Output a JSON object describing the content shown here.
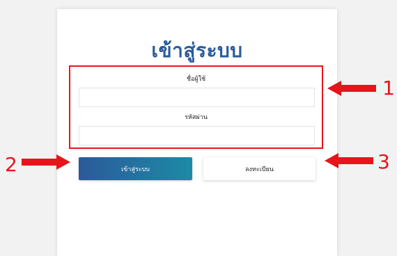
{
  "title": "เข้าสู่ระบบ",
  "form": {
    "username_label": "ชื่อผู้ใช้",
    "username_value": "",
    "password_label": "รหัสผ่าน",
    "password_value": ""
  },
  "buttons": {
    "login_label": "เข้าสู่ระบบ",
    "register_label": "ลงทะเบียน"
  },
  "annotations": {
    "n1": "1",
    "n2": "2",
    "n3": "3"
  },
  "colors": {
    "annotation": "#e8141b",
    "title": "#2a5b9c",
    "login_gradient_start": "#2b5a9a",
    "login_gradient_end": "#1d8aa6"
  }
}
